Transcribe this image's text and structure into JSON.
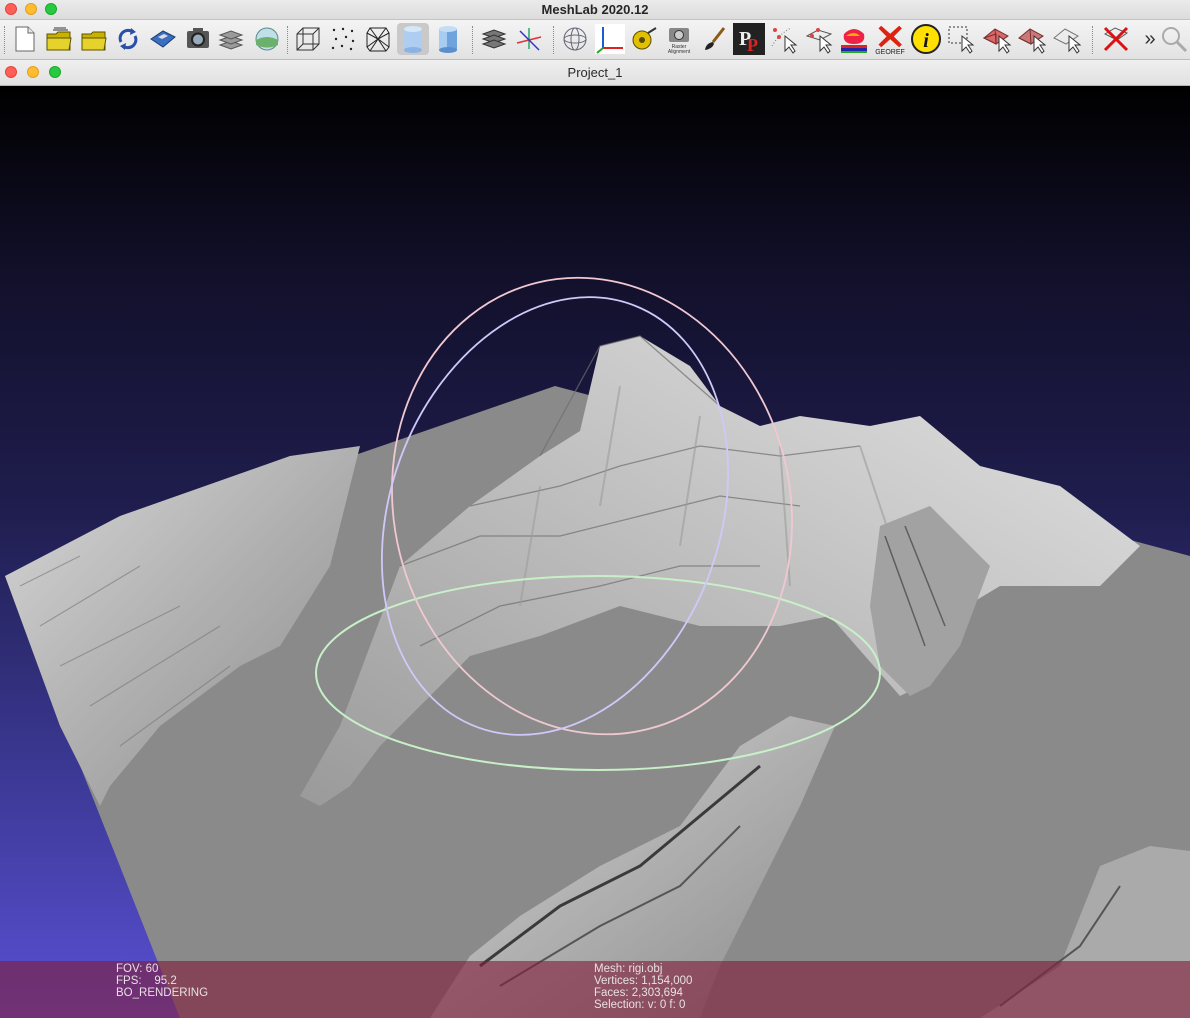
{
  "app": {
    "title": "MeshLab 2020.12"
  },
  "toolbar": {
    "buttons": [
      {
        "name": "new-project-icon"
      },
      {
        "name": "open-layer-icon"
      },
      {
        "name": "open-project-icon"
      },
      {
        "name": "reload-icon"
      },
      {
        "name": "save-icon"
      },
      {
        "name": "snapshot-icon"
      },
      {
        "name": "layers-icon"
      },
      {
        "name": "globe-view-icon"
      },
      {
        "name": "bounding-box-icon"
      },
      {
        "name": "points-icon"
      },
      {
        "name": "wireframe-icon"
      },
      {
        "name": "flat-shading-icon"
      },
      {
        "name": "smooth-shading-icon"
      },
      {
        "name": "light-icon"
      },
      {
        "name": "axis-icon"
      },
      {
        "name": "trackball-icon"
      },
      {
        "name": "align-axis-icon"
      },
      {
        "name": "measure-icon"
      },
      {
        "name": "raster-alignment-icon"
      },
      {
        "name": "paint-icon"
      },
      {
        "name": "pick-points-icon"
      },
      {
        "name": "select-vertex-icon"
      },
      {
        "name": "select-connected-icon"
      },
      {
        "name": "quality-mapper-icon"
      },
      {
        "name": "georef-icon"
      },
      {
        "name": "info-icon"
      },
      {
        "name": "select-faces-icon"
      },
      {
        "name": "select-region-icon"
      },
      {
        "name": "select-cone-icon"
      },
      {
        "name": "select-none-icon"
      },
      {
        "name": "delete-selection-icon"
      }
    ],
    "raster_alignment_label": "Raster\nAlignment",
    "georef_label": "GEOREF",
    "overflow_label": "»",
    "info_label": "i"
  },
  "document": {
    "title": "Project_1"
  },
  "hud": {
    "fov": "FOV: 60",
    "fps": "FPS:    95.2",
    "mode": "BO_RENDERING",
    "mesh": "Mesh: rigi.obj",
    "vertices": "Vertices: 1,154,000",
    "faces": "Faces: 2,303,694",
    "selection": "Selection: v: 0 f: 0"
  },
  "colors": {
    "background_top": "#000000",
    "background_bottom": "#5a50d4",
    "terrain": "#8a8a8a",
    "hud": "#801e3c"
  }
}
